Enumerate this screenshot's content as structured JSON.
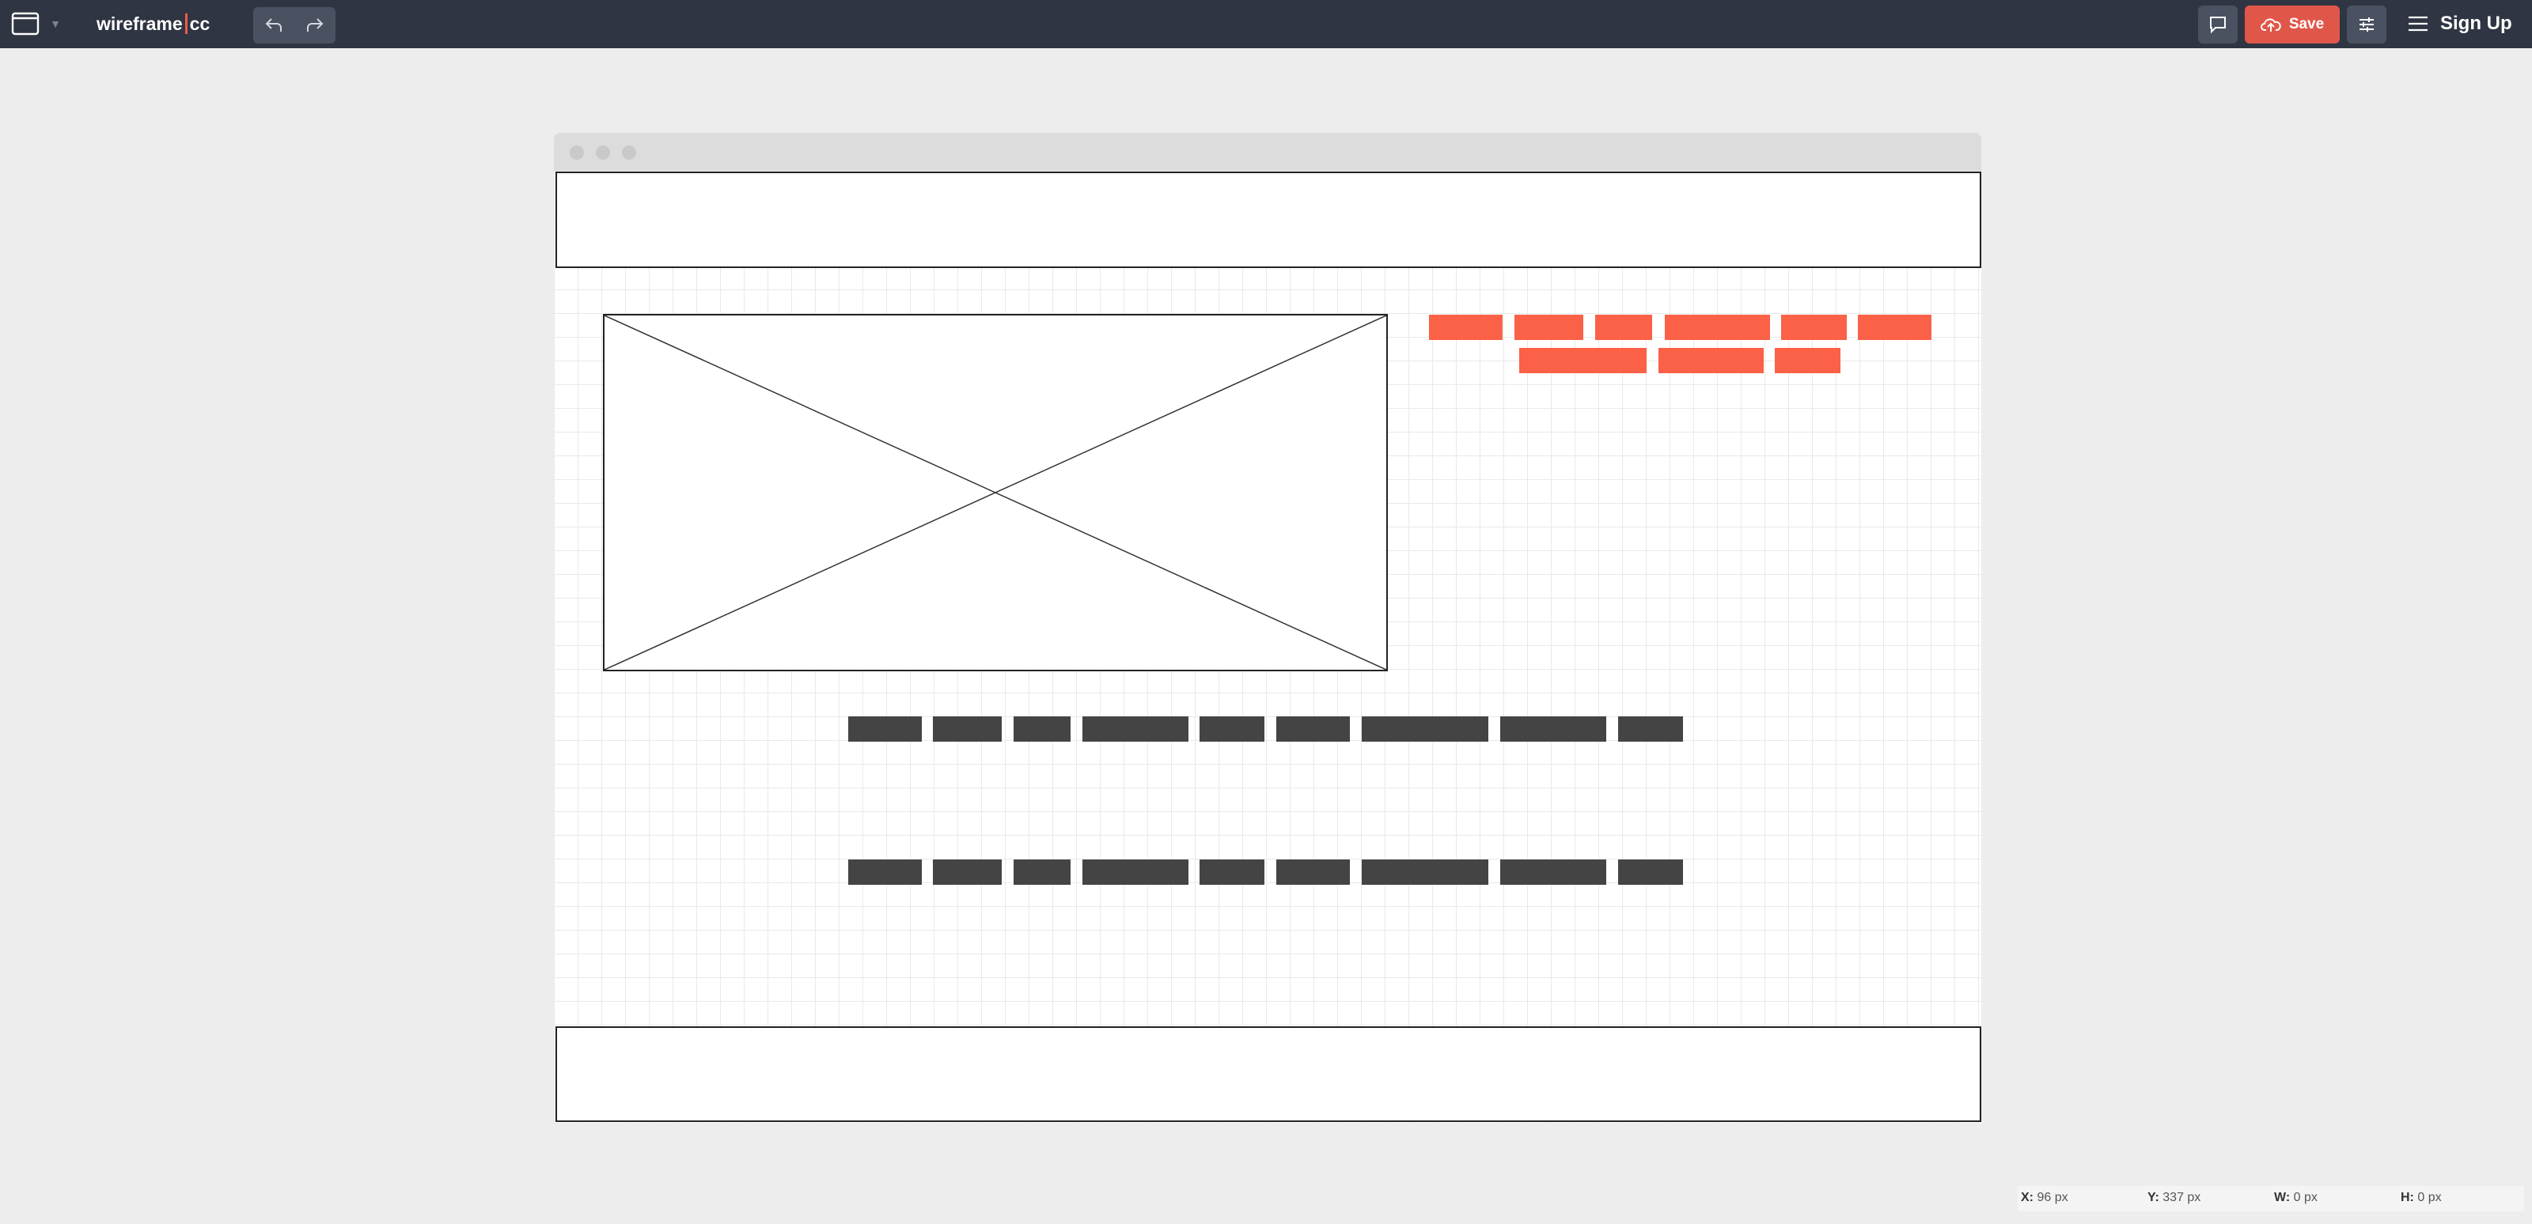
{
  "app": {
    "logo_left": "wireframe",
    "logo_right": "cc"
  },
  "toolbar": {
    "save_label": "Save",
    "signup_label": "Sign Up",
    "device_caret": "▼"
  },
  "statusbar": {
    "x_label": "X:",
    "x_value": "96 px",
    "y_label": "Y:",
    "y_value": "337 px",
    "w_label": "W:",
    "w_value": "0 px",
    "h_label": "H:",
    "h_value": "0 px"
  },
  "colors": {
    "accent": "#fa6147",
    "save": "#e0574a",
    "topbar": "#2f3542",
    "dark_block": "#444444"
  },
  "icons": {
    "device": "browser-window-icon",
    "undo": "undo-icon",
    "redo": "redo-icon",
    "comment": "comment-icon",
    "save": "cloud-upload-icon",
    "settings": "sliders-icon",
    "menu": "hamburger-menu-icon"
  }
}
